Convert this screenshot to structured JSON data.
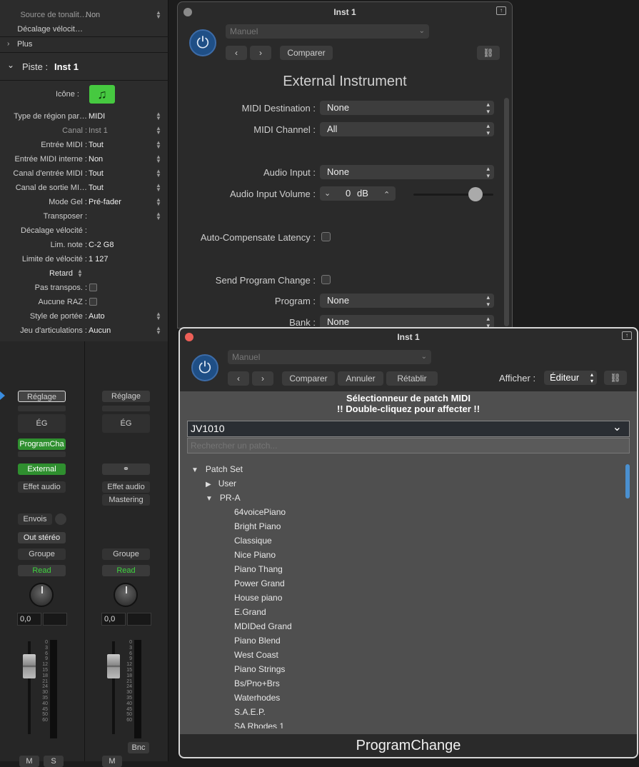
{
  "inspector": {
    "top_rows": [
      {
        "label": "Source de tonalit…",
        "value": "Non"
      },
      {
        "label": "Décalage vélocit…",
        "value": ""
      }
    ],
    "plus_label": "Plus",
    "track_header": {
      "prefix": "Piste :",
      "name": "Inst 1"
    },
    "icon_label": "Icône :",
    "rows": [
      {
        "label": "Type de région par…",
        "value": "MIDI"
      },
      {
        "label": "Canal :",
        "value": "Inst 1"
      },
      {
        "label": "Entrée MIDI :",
        "value": "Tout"
      },
      {
        "label": "Entrée MIDI interne :",
        "value": "Non"
      },
      {
        "label": "Canal d'entrée MIDI :",
        "value": "Tout"
      },
      {
        "label": "Canal de sortie MI…",
        "value": "Tout"
      },
      {
        "label": "Mode Gel :",
        "value": "Pré-fader"
      },
      {
        "label": "Transposer :",
        "value": ""
      },
      {
        "label": "Décalage vélocité :",
        "value": ""
      },
      {
        "label": "Lim. note :",
        "value": "C-2  G8"
      },
      {
        "label": "Limite de vélocité :",
        "value": "1  127"
      },
      {
        "label": "Retard",
        "value": ""
      },
      {
        "label": "Pas transpos. :",
        "value": ""
      },
      {
        "label": "Aucune RAZ :",
        "value": ""
      },
      {
        "label": "Style de portée :",
        "value": "Auto"
      },
      {
        "label": "Jeu d'articulations :",
        "value": "Aucun"
      }
    ]
  },
  "mixer": {
    "strip1": {
      "setting": "Réglage",
      "eq": "ÉG",
      "midi_fx": "ProgramCha",
      "instrument": "External",
      "audio_fx": "Effet audio",
      "sends": "Envois",
      "output": "Out stéréo",
      "group": "Groupe",
      "automation": "Read",
      "pan_value": "0,0",
      "m_label": "M",
      "s_label": "S"
    },
    "strip2": {
      "setting": "Réglage",
      "eq": "ÉG",
      "audio_fx": "Effet audio",
      "audio_fx2": "Mastering",
      "group": "Groupe",
      "automation": "Read",
      "pan_value": "0,0",
      "bnc": "Bnc",
      "m_label": "M"
    },
    "scale": [
      "0",
      "3",
      "6",
      "9",
      "12",
      "15",
      "18",
      "21",
      "24",
      "30",
      "35",
      "40",
      "45",
      "50",
      "60"
    ]
  },
  "plugin1": {
    "title": "Inst 1",
    "preset": "Manuel",
    "compare": "Comparer",
    "plugin_name": "External Instrument",
    "midi_destination": {
      "label": "MIDI Destination :",
      "value": "None"
    },
    "midi_channel": {
      "label": "MIDI Channel :",
      "value": "All"
    },
    "audio_input": {
      "label": "Audio Input :",
      "value": "None"
    },
    "audio_input_volume": {
      "label": "Audio Input Volume :",
      "value": "0",
      "unit": "dB",
      "slider_fraction": 0.78
    },
    "latency": {
      "label": "Auto-Compensate Latency :"
    },
    "send_pc": {
      "label": "Send Program Change :"
    },
    "program": {
      "label": "Program :",
      "value": "None"
    },
    "bank": {
      "label": "Bank :",
      "value": "None"
    }
  },
  "plugin2": {
    "title": "Inst 1",
    "preset": "Manuel",
    "compare": "Comparer",
    "undo": "Annuler",
    "redo": "Rétablir",
    "view_label": "Afficher :",
    "view_value": "Éditeur",
    "header_line1": "Sélectionneur de patch MIDI",
    "header_line2": "!! Double-cliquez pour affecter !!",
    "device": "JV1010",
    "search_placeholder": "Rechercher un patch...",
    "tree": {
      "root": "Patch Set",
      "user": "User",
      "pra": "PR-A",
      "patches": [
        "64voicePiano",
        "Bright Piano",
        "Classique",
        "Nice Piano",
        "Piano Thang",
        "Power Grand",
        "House piano",
        "E.Grand",
        "MDIDed Grand",
        "Piano Blend",
        "West Coast",
        "Piano Strings",
        "Bs/Pno+Brs",
        "Waterhodes",
        "S.A.E.P.",
        "SA Rhodes 1"
      ]
    },
    "footer": "ProgramChange"
  },
  "colors": {
    "accent_green": "#3fbf3f",
    "power_blue": "#1f4f86",
    "read_green": "#3ed43e",
    "close_red": "#ec5f57"
  }
}
